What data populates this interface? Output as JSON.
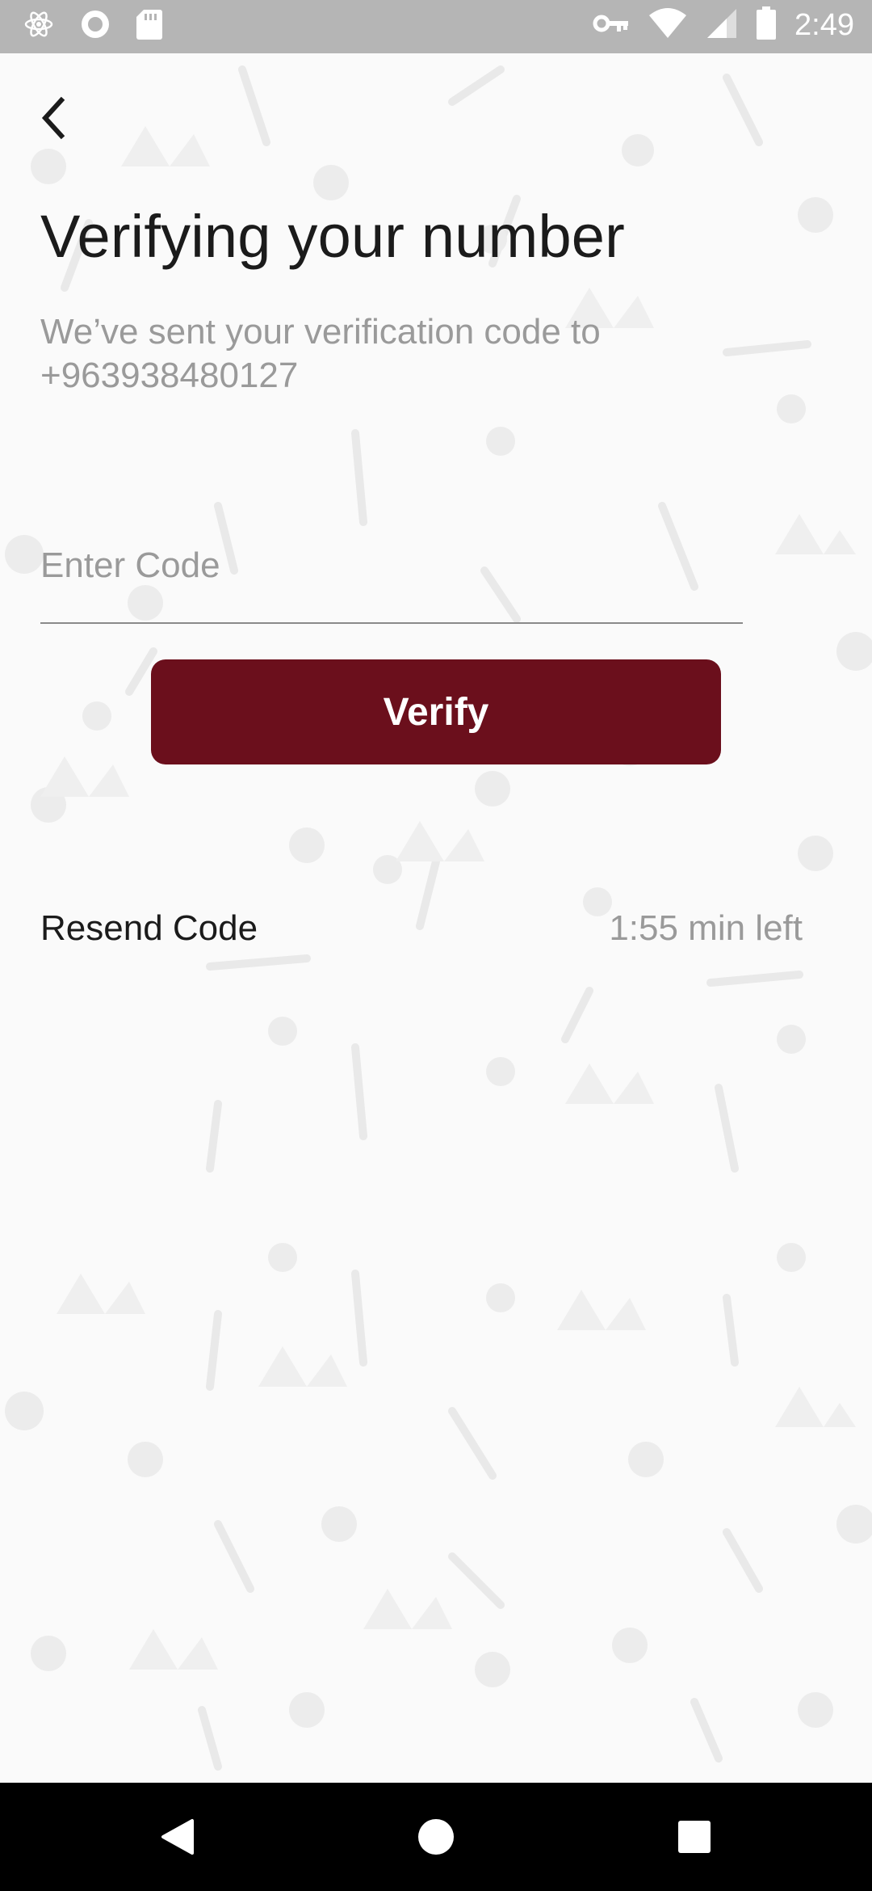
{
  "status_bar": {
    "time": "2:49",
    "icons": [
      "atom-icon",
      "circle-status-icon",
      "sd-card-icon",
      "key-icon",
      "wifi-icon",
      "signal-icon",
      "battery-icon"
    ]
  },
  "header": {
    "back_icon": "chevron-left-icon"
  },
  "main": {
    "title": "Verifying your number",
    "subtitle_line1": "We’ve sent your verification code to",
    "subtitle_line2": "+963938480127",
    "code_placeholder": "Enter Code",
    "code_value": "",
    "verify_label": "Verify",
    "resend_label": "Resend Code",
    "timer_text": "1:55 min left"
  },
  "nav_bar": {
    "icons": [
      "back-triangle-icon",
      "home-circle-icon",
      "recents-square-icon"
    ]
  },
  "colors": {
    "accent": "#6b0f1c",
    "status_bar": "#b5b5b5",
    "background": "#fafafa",
    "muted_text": "#9a9a9a",
    "primary_text": "#1b1b1b"
  }
}
